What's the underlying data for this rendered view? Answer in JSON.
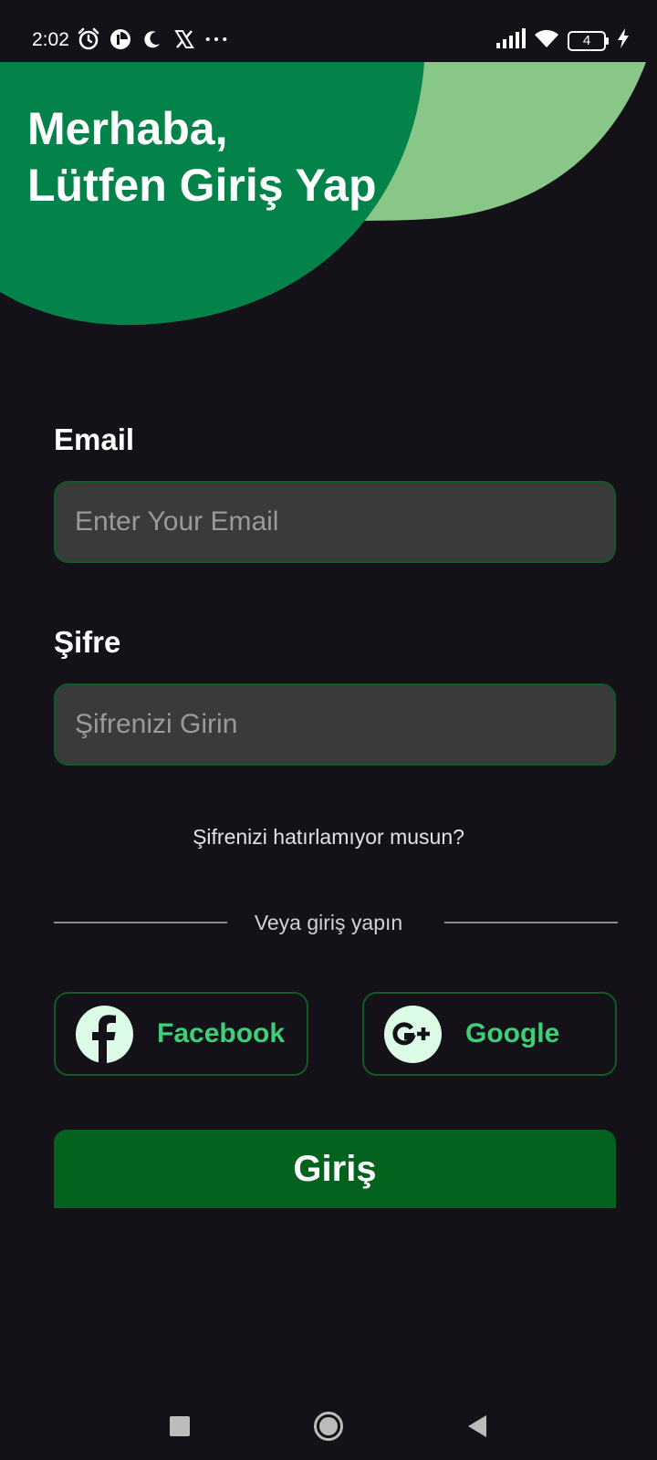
{
  "status_bar": {
    "time": "2:02",
    "battery_level": "4",
    "left_icons": [
      "alarm-icon",
      "pie-app-icon",
      "moon-icon",
      "x-logo-icon",
      "more-dots-icon"
    ],
    "right_icons": [
      "signal-icon",
      "wifi-icon",
      "battery-icon",
      "charging-icon"
    ]
  },
  "header": {
    "greeting_line1": "Merhaba,",
    "greeting_line2": "Lütfen Giriş Yap"
  },
  "form": {
    "email_label": "Email",
    "email_placeholder": "Enter Your Email",
    "email_value": "",
    "password_label": "Şifre",
    "password_placeholder": "Şifrenizi Girin",
    "password_value": "",
    "forgot_password": "Şifrenizi hatırlamıyor musun?"
  },
  "social": {
    "divider_text": "Veya giriş yapın",
    "facebook_label": "Facebook",
    "google_label": "Google"
  },
  "actions": {
    "login_label": "Giriş"
  },
  "nav_bar": {
    "buttons": [
      "recents-square-icon",
      "home-circle-icon",
      "back-triangle-icon"
    ]
  },
  "colors": {
    "background": "#141218",
    "primary_green": "#03824a",
    "light_green": "#88c787",
    "accent_text_green": "#3ecf79",
    "button_green": "#03621d",
    "input_background": "#3a3a3a",
    "input_border": "#0f5a25"
  }
}
